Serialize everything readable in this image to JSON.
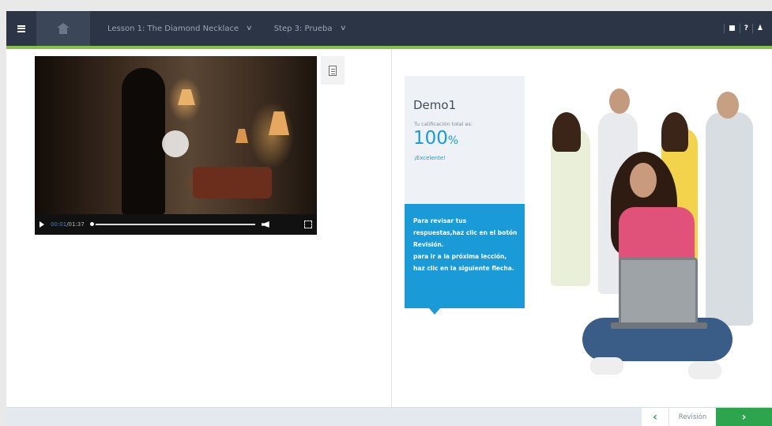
{
  "header": {
    "lesson_label": "Lesson 1: The Diamond Necklace",
    "step_label": "Step 3: Prueba",
    "icons": [
      "menu-icon",
      "home-icon",
      "chevron-down-icon",
      "book-icon",
      "help-icon",
      "user-icon"
    ],
    "help_glyph": "?",
    "book_glyph": "■",
    "user_glyph": "♟"
  },
  "video": {
    "current_time": "00:01",
    "duration": "/01:37",
    "progress_fraction": 0.01
  },
  "score": {
    "title": "Demo1",
    "label": "Tu calificación total es:",
    "value": "100",
    "unit": "%",
    "remark": "¡Excelente!"
  },
  "info": {
    "line1": "Para revisar tus respuestas,haz clic en el botón Revisión.",
    "line2": "para ir a la próxima lección, haz clic en la siguiente flecha."
  },
  "footer": {
    "prev_glyph": "‹",
    "revision_label": "Revisión",
    "next_glyph": "›"
  },
  "colors": {
    "topbar": "#2b3545",
    "accent_green": "#86c04a",
    "score_blue": "#1a9bd7",
    "next_green": "#2da44e"
  }
}
